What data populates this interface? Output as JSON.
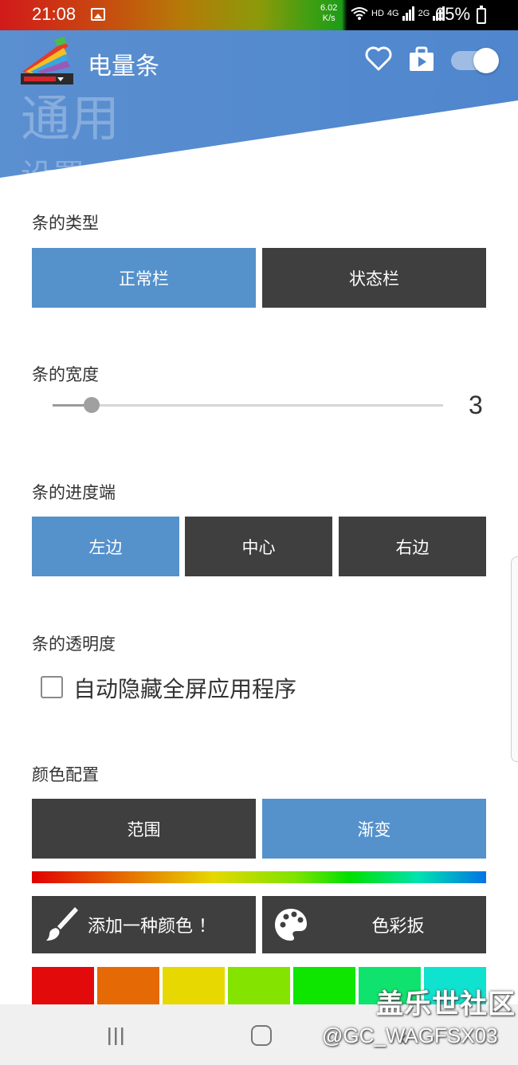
{
  "status_bar": {
    "time": "21:08",
    "speed_value": "6.02",
    "speed_unit": "K/s",
    "hd": "HD",
    "net1": "4G",
    "net2": "2G",
    "battery_pct": "65%"
  },
  "header": {
    "app_title": "电量条",
    "big_title": "通用",
    "big_subtitle": "设置",
    "toggle_on": true
  },
  "bar_type": {
    "label": "条的类型",
    "options": [
      "正常栏",
      "状态栏"
    ],
    "selected": 0
  },
  "bar_width": {
    "label": "条的宽度",
    "value": "3",
    "slider_fraction": 0.1
  },
  "bar_progress_end": {
    "label": "条的进度端",
    "options": [
      "左边",
      "中心",
      "右边"
    ],
    "selected": 0
  },
  "bar_transparency": {
    "label": "条的透明度",
    "checkbox_label": "自动隐藏全屏应用程序",
    "checked": false
  },
  "color_config": {
    "label": "颜色配置",
    "options": [
      "范围",
      "渐变"
    ],
    "selected": 1,
    "add_color_label": "添加一种颜色 ！",
    "palette_label": "色彩扳",
    "swatches": [
      "#e20a0a",
      "#e56a05",
      "#e6d800",
      "#85e300",
      "#0ee600",
      "#0fe36d",
      "#0fe3cf"
    ]
  },
  "watermark": {
    "line1": "盖乐世社区",
    "line2": "@GC_WAGFSX03"
  }
}
